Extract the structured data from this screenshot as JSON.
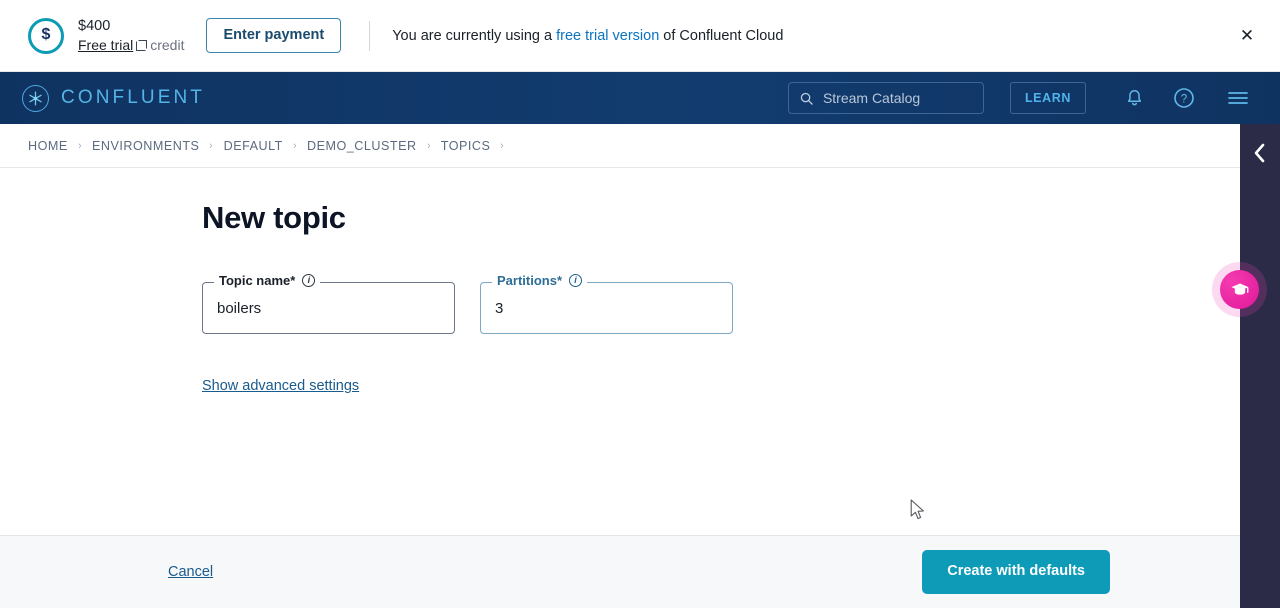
{
  "banner": {
    "amount": "$400",
    "free_trial_link": "Free trial",
    "credit_label": "credit",
    "enter_payment_label": "Enter payment",
    "message_prefix": "You are currently using a ",
    "message_link": "free trial version",
    "message_suffix": " of Confluent Cloud",
    "close_label": "✕",
    "accent_color": "#0b73c0",
    "dollar_glyph": "$",
    "icon_color": "#0b9bb5"
  },
  "topnav": {
    "brand": "CONFLUENT",
    "search": {
      "placeholder": "Stream Catalog",
      "value": ""
    },
    "learn_label": "LEARN",
    "background_color": "#113a6b",
    "brand_color": "#54b4e8"
  },
  "breadcrumbs": {
    "separator": "›",
    "items": [
      {
        "label": "HOME"
      },
      {
        "label": "ENVIRONMENTS"
      },
      {
        "label": "DEFAULT"
      },
      {
        "label": "DEMO_CLUSTER"
      },
      {
        "label": "TOPICS"
      }
    ]
  },
  "main": {
    "title": "New topic",
    "fields": [
      {
        "label": "Topic name*",
        "value": "boilers",
        "focused": false
      },
      {
        "label": "Partitions*",
        "value": "3",
        "focused": true
      }
    ],
    "advanced_link": "Show advanced settings",
    "info_glyph": "i"
  },
  "footer": {
    "cancel_label": "Cancel",
    "create_label": "Create with defaults",
    "create_color": "#0d9bb8"
  },
  "right_rail": {
    "collapse_chevron": "‹",
    "background_color": "#2c2b47"
  },
  "tutorial_fab": {
    "icon": "graduation-cap",
    "color": "#e9259e"
  }
}
